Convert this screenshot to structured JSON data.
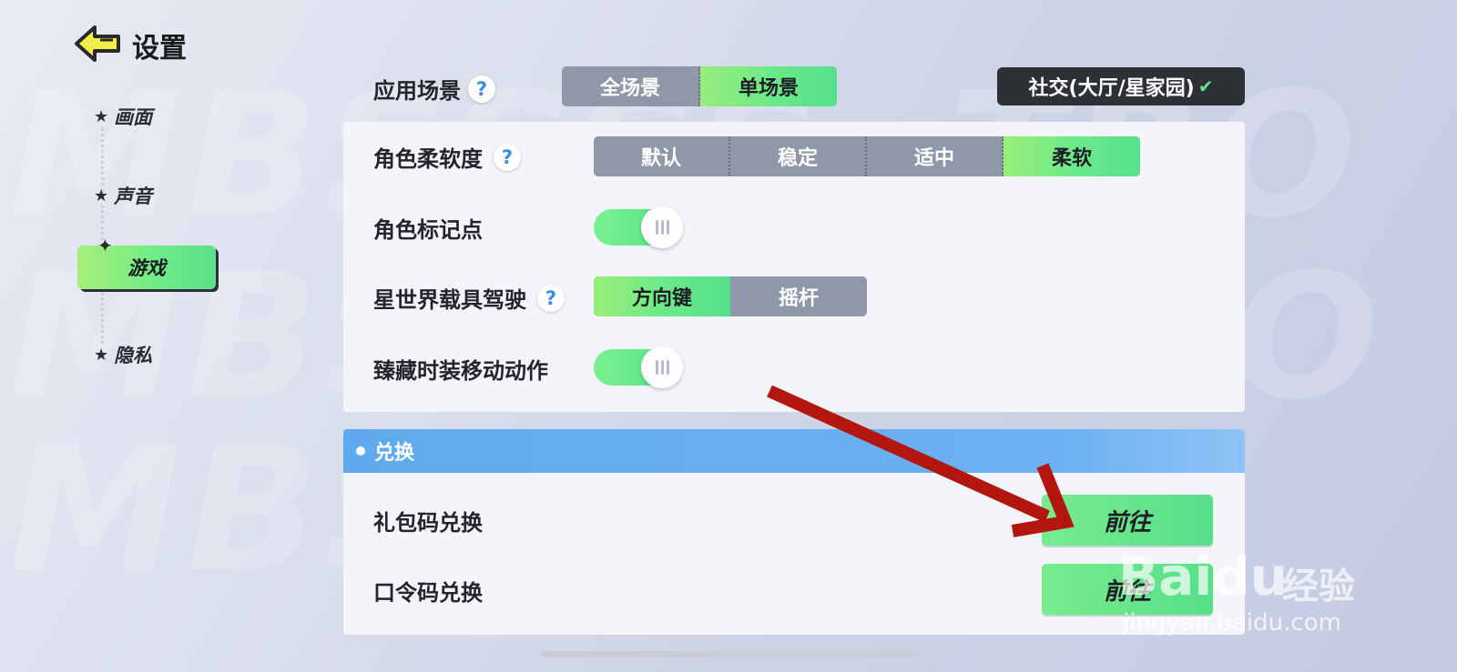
{
  "header": {
    "title": "设置"
  },
  "sidebar": {
    "items": [
      {
        "label": "画面"
      },
      {
        "label": "声音"
      },
      {
        "label": "游戏"
      },
      {
        "label": "隐私"
      }
    ]
  },
  "scene": {
    "label": "应用场景",
    "options": [
      "全场景",
      "单场景"
    ],
    "selected": "单场景",
    "dropdown_value": "社交(大厅/星家园)"
  },
  "settings": {
    "softness": {
      "label": "角色柔软度",
      "options": [
        "默认",
        "稳定",
        "适中",
        "柔软"
      ],
      "selected": "柔软"
    },
    "marker": {
      "label": "角色标记点",
      "on": true
    },
    "driving": {
      "label": "星世界载具驾驶",
      "options": [
        "方向键",
        "摇杆"
      ],
      "selected": "方向键"
    },
    "outfit_motion": {
      "label": "臻藏时装移动动作",
      "on": true
    }
  },
  "redeem": {
    "section_title": "兑换",
    "rows": [
      {
        "label": "礼包码兑换",
        "button": "前往"
      },
      {
        "label": "口令码兑换",
        "button": "前往"
      }
    ]
  },
  "watermark": {
    "logo": "Baidu",
    "sub": "经验",
    "url": "jingyan.baidu.com"
  },
  "colors": {
    "accent_green": "#6ae98a",
    "section_blue": "#5fa9ee",
    "arrow_red": "#b3160e"
  },
  "icons": {
    "back": "back-arrow-icon",
    "help": "question-icon",
    "star": "star-icon",
    "chevron": "chevron-down-icon"
  }
}
